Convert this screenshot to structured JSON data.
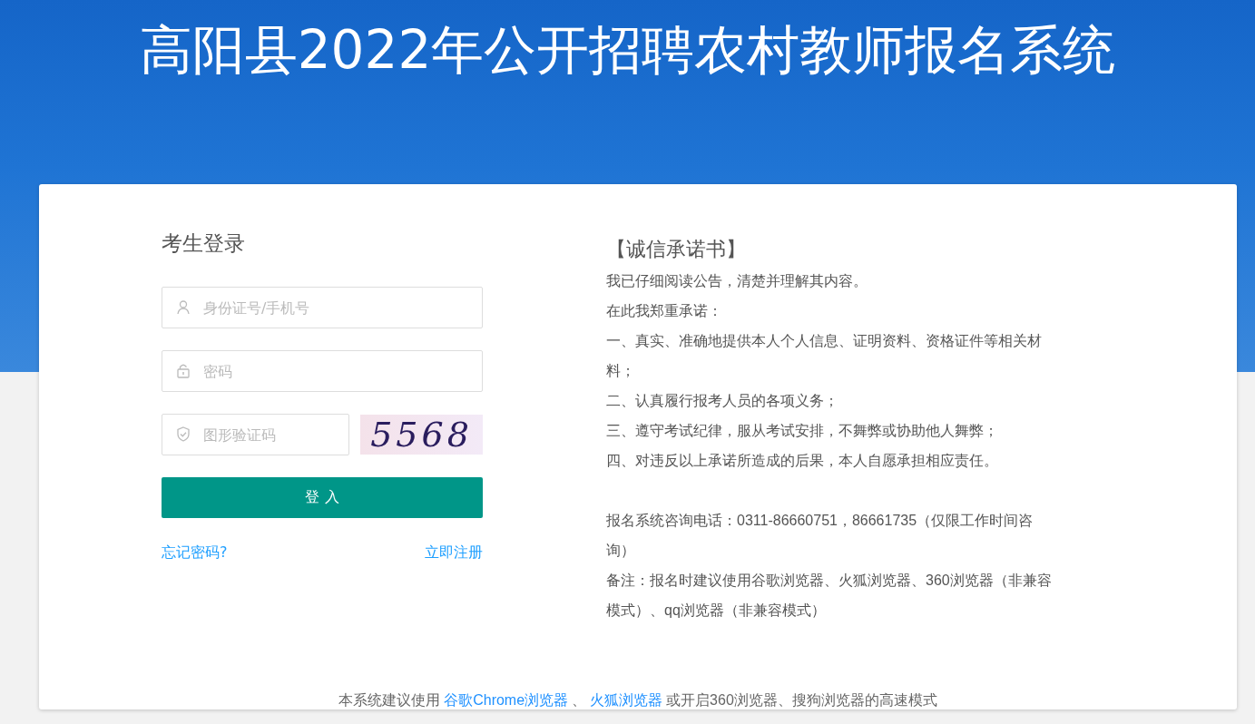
{
  "header": {
    "title": "高阳县2022年公开招聘农村教师报名系统"
  },
  "login": {
    "title": "考生登录",
    "fields": [
      {
        "kind": "user",
        "placeholder": "身份证号/手机号"
      },
      {
        "kind": "lock",
        "placeholder": "密码"
      }
    ],
    "captcha": {
      "placeholder": "图形验证码",
      "code": "5568"
    },
    "submit": "登 入",
    "links": [
      {
        "label": "忘记密码?"
      },
      {
        "label": "立即注册"
      }
    ]
  },
  "pledge": {
    "title": "【诚信承诺书】",
    "paragraphs": [
      "我已仔细阅读公告，清楚并理解其内容。",
      "在此我郑重承诺：",
      "一、真实、准确地提供本人个人信息、证明资料、资格证件等相关材料；",
      "二、认真履行报考人员的各项义务；",
      "三、遵守考试纪律，服从考试安排，不舞弊或协助他人舞弊；",
      "四、对违反以上承诺所造成的后果，本人自愿承担相应责任。"
    ],
    "notes": [
      "报名系统咨询电话：0311-86660751，86661735（仅限工作时间咨询）",
      "备注：报名时建议使用谷歌浏览器、火狐浏览器、360浏览器（非兼容模式）、qq浏览器（非兼容模式）"
    ]
  },
  "footer_note": [
    {
      "kind": "text",
      "text": "本系统建议使用"
    },
    {
      "kind": "link",
      "text": "谷歌Chrome浏览器"
    },
    {
      "kind": "text",
      "text": "、"
    },
    {
      "kind": "link",
      "text": "火狐浏览器"
    },
    {
      "kind": "text",
      "text": "或开启360浏览器、搜狗浏览器的高速模式"
    }
  ]
}
